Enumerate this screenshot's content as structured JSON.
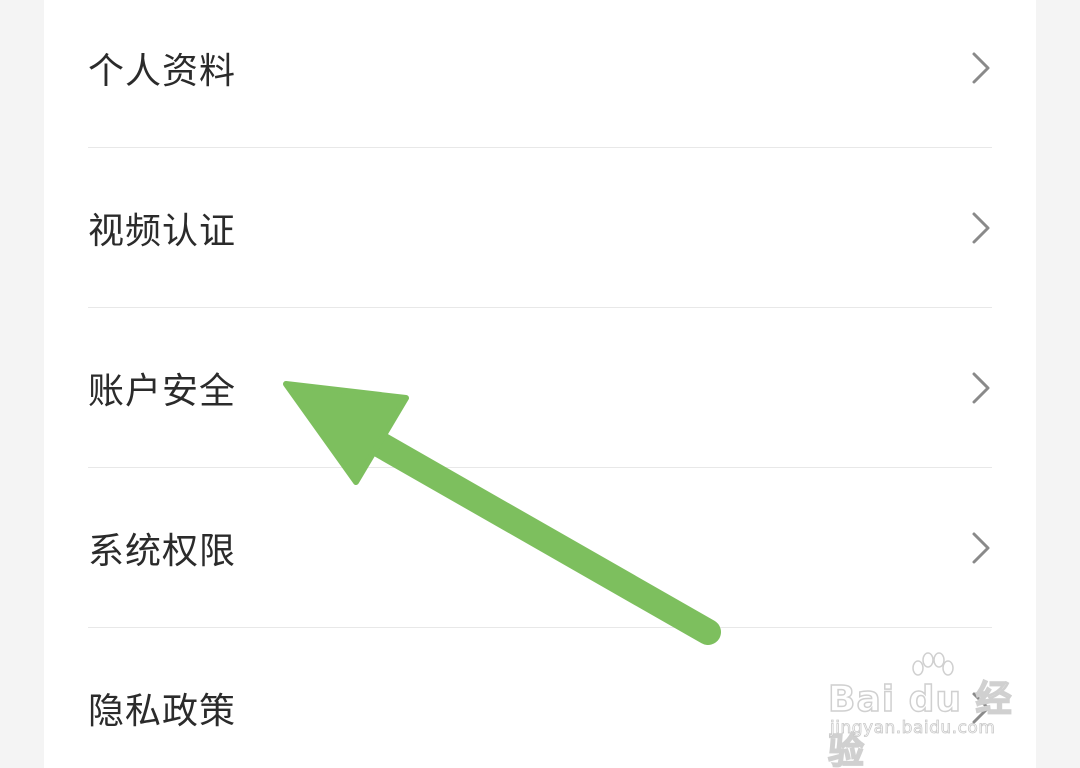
{
  "settings_menu": {
    "items": [
      {
        "label": "个人资料",
        "icon": "chevron-right-icon"
      },
      {
        "label": "视频认证",
        "icon": "chevron-right-icon"
      },
      {
        "label": "账户安全",
        "icon": "chevron-right-icon"
      },
      {
        "label": "系统权限",
        "icon": "chevron-right-icon"
      },
      {
        "label": "隐私政策",
        "icon": "chevron-right-icon"
      }
    ]
  },
  "annotation": {
    "arrow_color": "#7dbf5e",
    "points_to": "账户安全"
  },
  "watermark": {
    "brand": "Bai du 经验",
    "domain": "jingyan.baidu.com"
  },
  "colors": {
    "background": "#f4f4f4",
    "card": "#ffffff",
    "divider": "#e8e8e8",
    "text": "#2b2b2b",
    "chevron": "#8a8a8a"
  }
}
